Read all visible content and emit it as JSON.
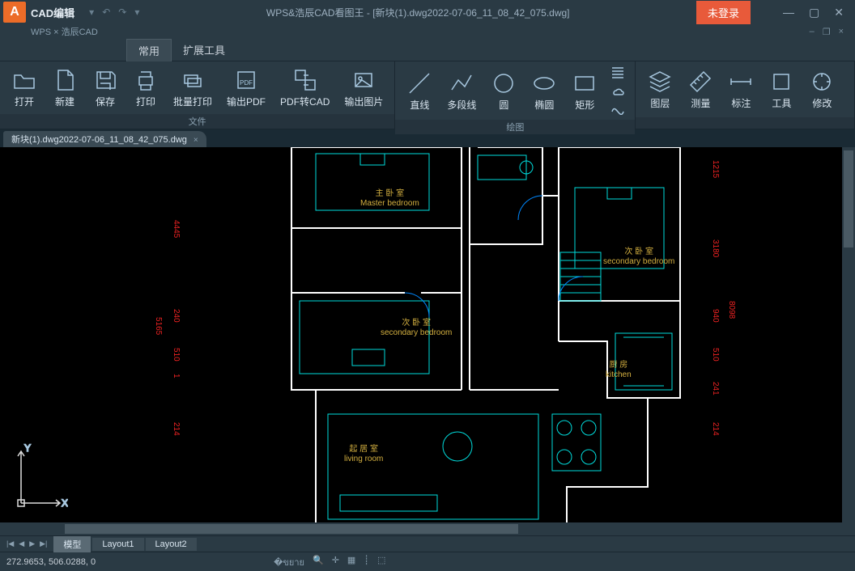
{
  "app": {
    "name": "CAD编辑",
    "subtitle": "WPS × 浩辰CAD",
    "window_title": "WPS&浩辰CAD看图王 - [新块(1).dwg2022-07-06_11_08_42_075.dwg]",
    "login_button": "未登录"
  },
  "ribbon_tabs": {
    "common": "常用",
    "extend": "扩展工具"
  },
  "ribbon": {
    "file_group": "文件",
    "draw_group": "绘图",
    "open": "打开",
    "new": "新建",
    "save": "保存",
    "print": "打印",
    "batch_print": "批量打印",
    "export_pdf": "输出PDF",
    "pdf_to_cad": "PDF转CAD",
    "export_img": "输出图片",
    "line": "直线",
    "polyline": "多段线",
    "circle": "圆",
    "ellipse": "椭圆",
    "rect": "矩形",
    "layer": "图层",
    "measure": "测量",
    "annotate": "标注",
    "tools": "工具",
    "modify": "修改"
  },
  "file_tab": "新块(1).dwg2022-07-06_11_08_42_075.dwg",
  "rooms": {
    "master": {
      "cn": "主 卧 室",
      "en": "Master bedroom"
    },
    "secondary1": {
      "cn": "次 卧 室",
      "en": "secondary bedroom"
    },
    "secondary2": {
      "cn": "次 卧 室",
      "en": "secondary bedroom"
    },
    "kitchen": {
      "cn": "厨 房",
      "en": "kitchen"
    },
    "living": {
      "cn": "起 居 室",
      "en": "living room"
    }
  },
  "dims": {
    "left1": "4445",
    "left2": "5165",
    "left3": "240",
    "left4": "510",
    "left5": "1",
    "left6": "214",
    "right1": "1215",
    "right2": "3180",
    "right3": "8098",
    "right4": "940",
    "right5": "510",
    "right6": "241",
    "right7": "214"
  },
  "ucs": {
    "x": "X",
    "y": "Y"
  },
  "layout": {
    "model": "模型",
    "l1": "Layout1",
    "l2": "Layout2"
  },
  "status": {
    "coords": "272.9653, 506.0288, 0"
  }
}
